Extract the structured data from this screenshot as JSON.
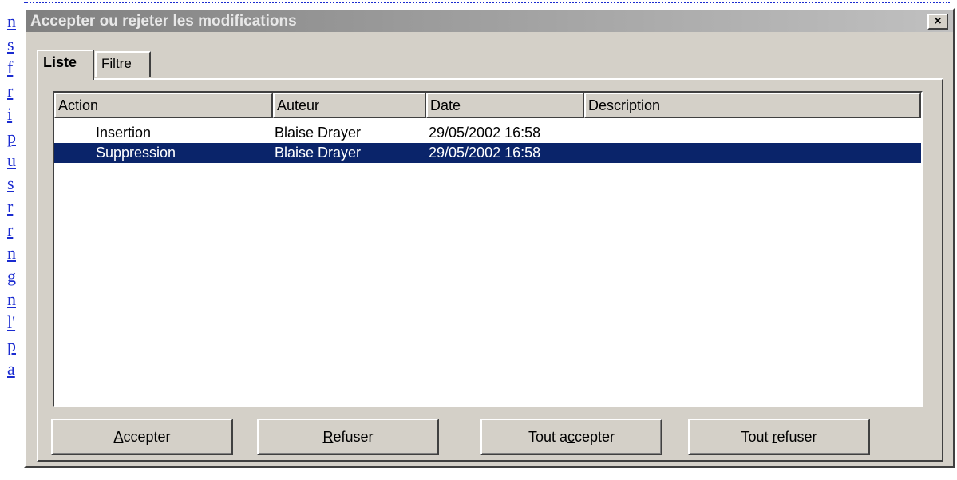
{
  "background": {
    "letters": [
      "n",
      "s",
      "f",
      "r",
      "i",
      "p",
      "u",
      "s",
      "r",
      "r",
      "n",
      "g",
      "n",
      "l'",
      "p",
      "a"
    ]
  },
  "dialog": {
    "title": "Accepter ou rejeter les modifications",
    "close_label": "×"
  },
  "tabs": [
    {
      "label": "Liste",
      "active": true
    },
    {
      "label": "Filtre",
      "active": false
    }
  ],
  "list": {
    "columns": [
      "Action",
      "Auteur",
      "Date",
      "Description"
    ],
    "rows": [
      {
        "action": "Insertion",
        "author": "Blaise Drayer",
        "date": "29/05/2002 16:58",
        "description": "",
        "selected": false
      },
      {
        "action": "Suppression",
        "author": "Blaise Drayer",
        "date": "29/05/2002 16:58",
        "description": "",
        "selected": true
      }
    ]
  },
  "buttons": [
    {
      "pre": "",
      "key": "A",
      "post": "ccepter"
    },
    {
      "pre": "",
      "key": "R",
      "post": "efuser"
    },
    {
      "pre": "Tout a",
      "key": "c",
      "post": "cepter"
    },
    {
      "pre": "Tout ",
      "key": "r",
      "post": "efuser"
    }
  ],
  "colors": {
    "selection": "#0a246a",
    "face": "#d4d0c8",
    "link": "#1a2bd0"
  }
}
